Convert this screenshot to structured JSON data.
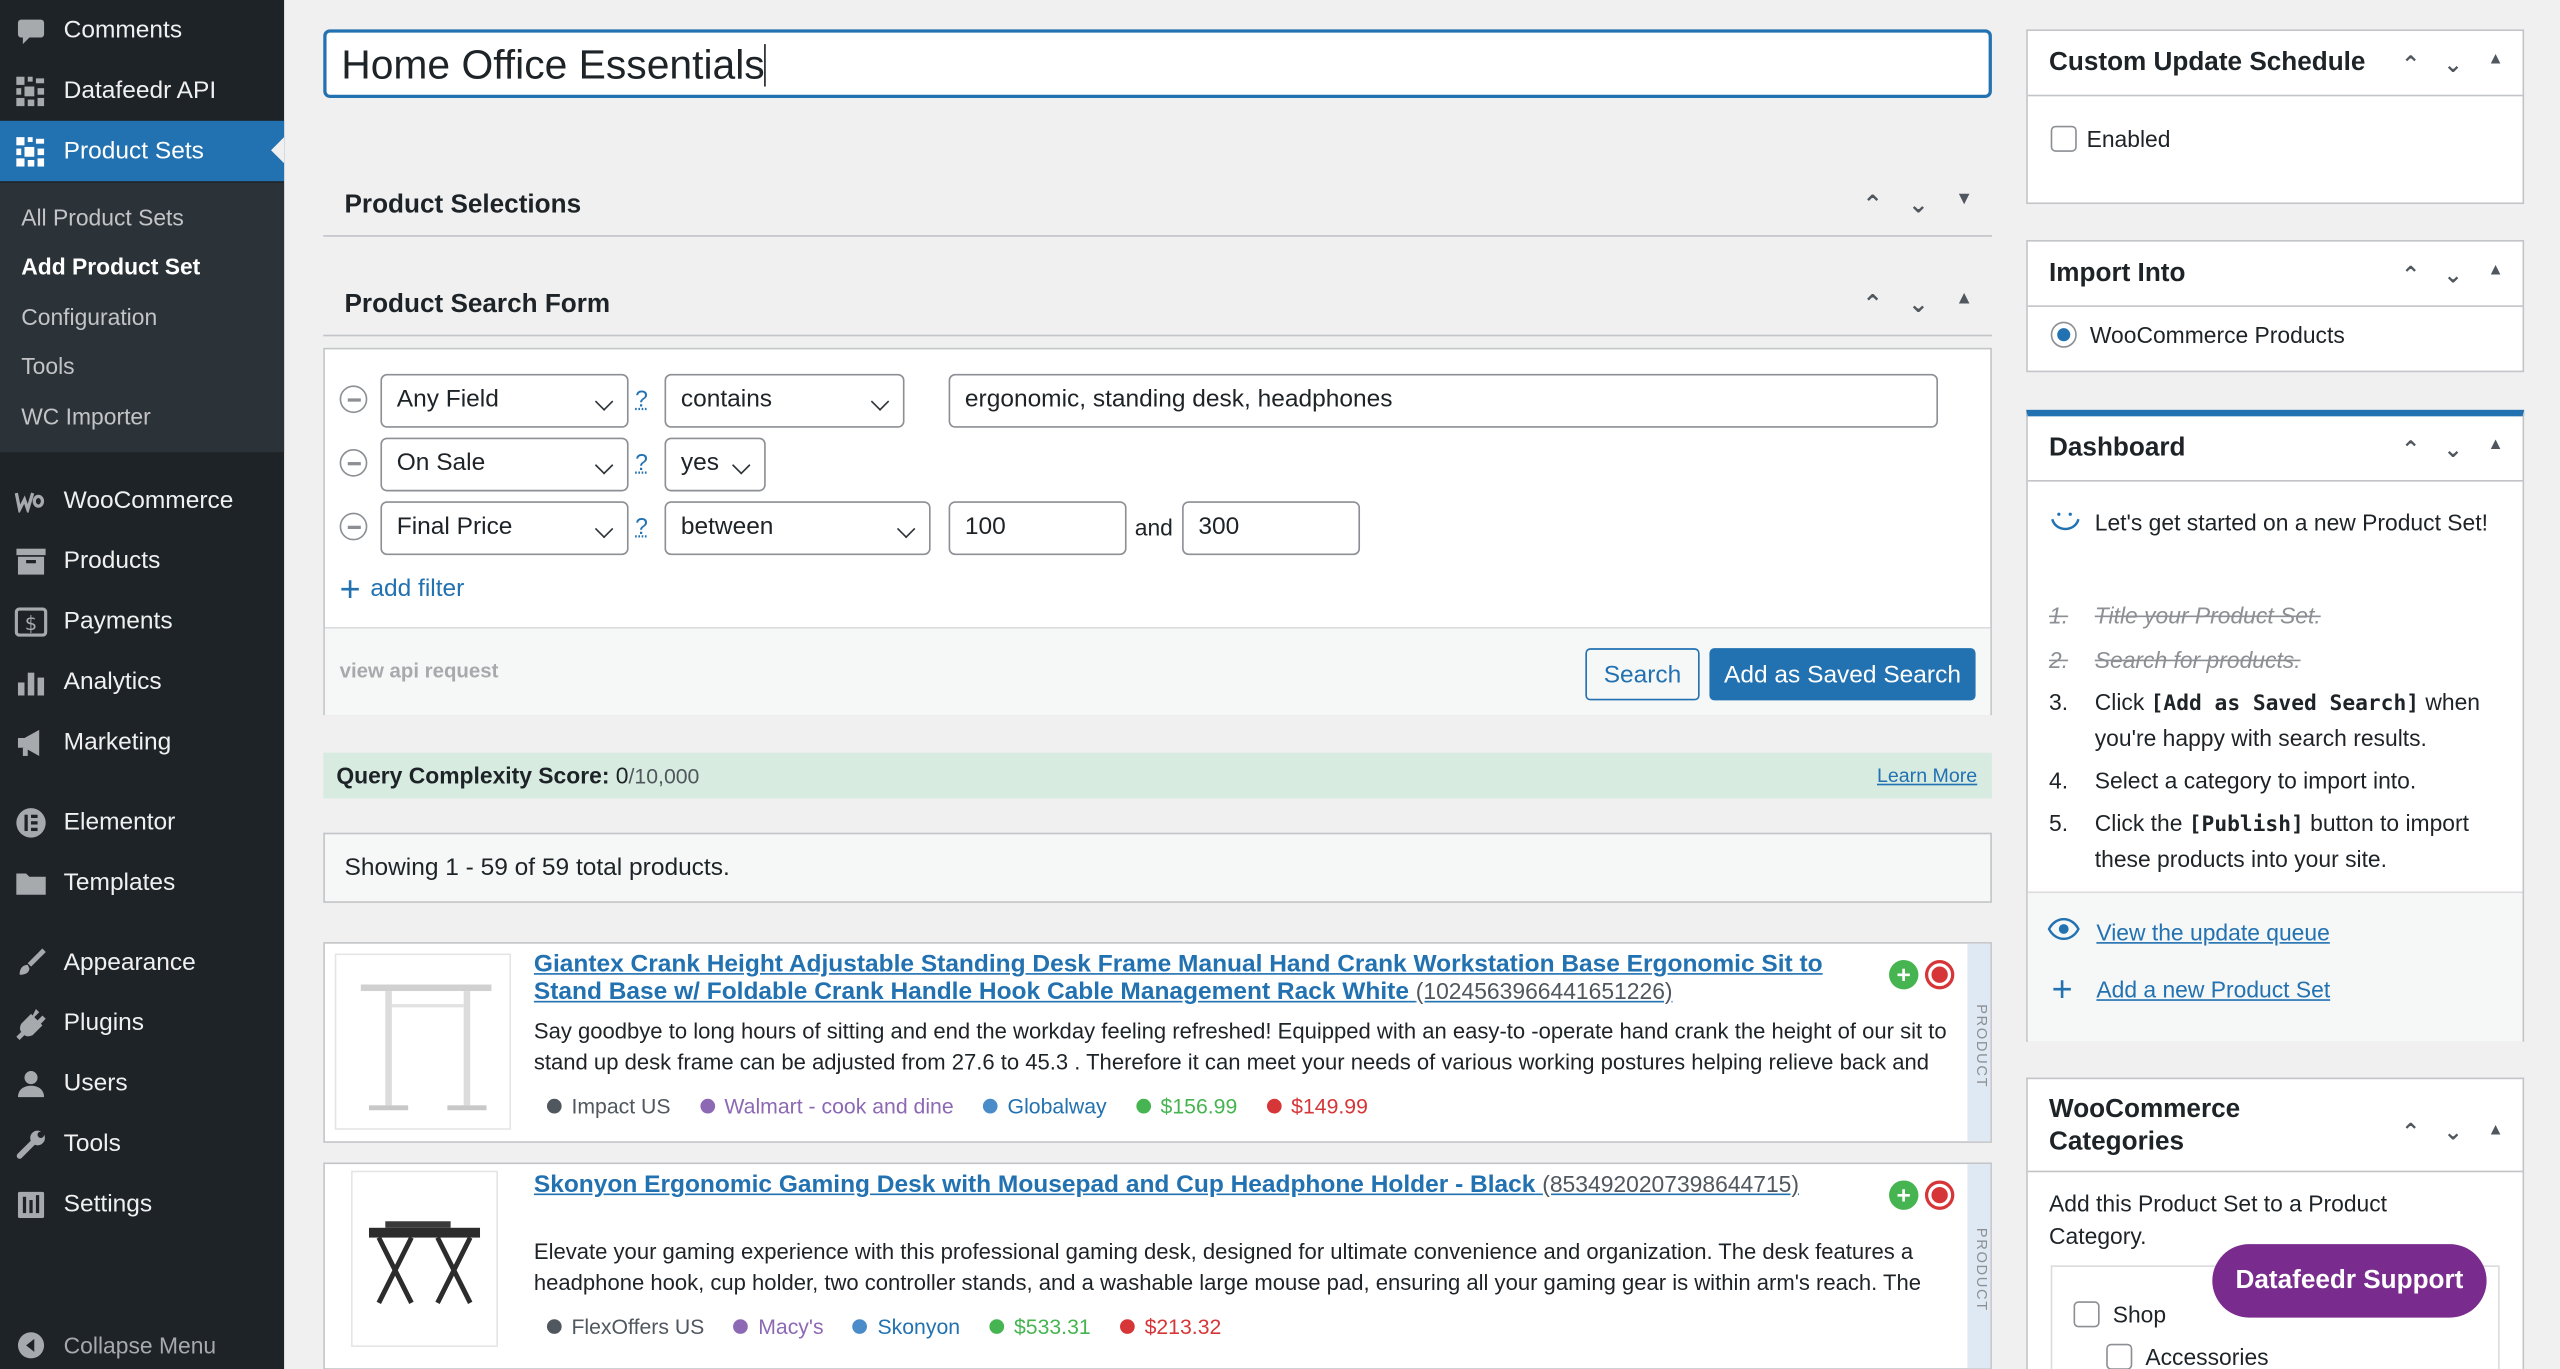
{
  "sidebar": {
    "top_items": [
      {
        "label": "Comments",
        "icon": "comment-icon"
      },
      {
        "label": "Datafeedr API",
        "icon": "grid-icon"
      },
      {
        "label": "Product Sets",
        "icon": "grid-icon"
      }
    ],
    "submenu": [
      "All Product Sets",
      "Add Product Set",
      "Configuration",
      "Tools",
      "WC Importer"
    ],
    "items": [
      {
        "label": "WooCommerce",
        "icon": "woo-icon"
      },
      {
        "label": "Products",
        "icon": "archive-icon"
      },
      {
        "label": "Payments",
        "icon": "dollar-icon"
      },
      {
        "label": "Analytics",
        "icon": "bar-chart-icon"
      },
      {
        "label": "Marketing",
        "icon": "megaphone-icon"
      },
      {
        "label": "Elementor",
        "icon": "elementor-icon"
      },
      {
        "label": "Templates",
        "icon": "folder-icon"
      },
      {
        "label": "Appearance",
        "icon": "brush-icon"
      },
      {
        "label": "Plugins",
        "icon": "plug-icon"
      },
      {
        "label": "Users",
        "icon": "user-icon"
      },
      {
        "label": "Tools",
        "icon": "wrench-icon"
      },
      {
        "label": "Settings",
        "icon": "settings-icon"
      }
    ],
    "collapse": "Collapse Menu"
  },
  "title_value": "Home Office Essentials",
  "boxes": {
    "selections": "Product Selections",
    "search_form": "Product Search Form"
  },
  "filters": [
    {
      "field": "Any Field",
      "op": "contains",
      "value": "ergonomic, standing desk, headphones"
    },
    {
      "field": "On Sale",
      "op": "yes"
    },
    {
      "field": "Final Price",
      "op": "between",
      "min": "100",
      "and": "and",
      "max": "300"
    }
  ],
  "help": "?",
  "add_filter": "add filter",
  "view_api": "view api request",
  "search_btn": "Search",
  "saved_btn": "Add as Saved Search",
  "complexity": {
    "label": "Query Complexity Score:",
    "score": "0",
    "max": "/10,000",
    "learn": "Learn More"
  },
  "showing": "Showing 1 - 59 of 59 total products.",
  "products": [
    {
      "title": "Giantex Crank Height Adjustable Standing Desk Frame Manual Hand Crank Workstation Base Ergonomic Sit to Stand Base w/ Foldable Crank Handle Hook Cable Management Rack White",
      "id": "(1024563966441651226)",
      "desc": "Say goodbye to long hours of sitting and end the workday feeling refreshed! Equipped with an easy-to -operate hand crank the height of our sit to stand up desk frame can be adjusted from 27.6 to 45.3 . Therefore it can meet your needs of various working postures helping relieve back and",
      "network": "Impact US",
      "merchant": "Walmart - cook and dine",
      "brand": "Globalway",
      "price": "$156.99",
      "sale": "$149.99"
    },
    {
      "title": "Skonyon Ergonomic Gaming Desk with Mousepad and Cup Headphone Holder - Black",
      "id": "(8534920207398644715)",
      "desc": "Elevate your gaming experience with this professional gaming desk, designed for ultimate convenience and organization. The desk features a headphone hook, cup holder, two controller stands, and a washable large mouse pad, ensuring all your gaming gear is within arm's reach. The",
      "network": "FlexOffers US",
      "merchant": "Macy's",
      "brand": "Skonyon",
      "price": "$533.31",
      "sale": "$213.32"
    }
  ],
  "product_strip": "PRODUCT",
  "right": {
    "schedule": {
      "title": "Custom Update Schedule",
      "enabled": "Enabled"
    },
    "import": {
      "title": "Import Into",
      "option": "WooCommerce Products"
    },
    "dashboard": {
      "title": "Dashboard",
      "intro": "Let's get started on a new Product Set!",
      "steps": [
        {
          "n": "1.",
          "text": "Title your Product Set."
        },
        {
          "n": "2.",
          "text": "Search for products."
        },
        {
          "n": "3.",
          "pre": "Click ",
          "bold": "[Add as Saved Search]",
          "post": " when you're happy with search results."
        },
        {
          "n": "4.",
          "text": "Select a category to import into."
        },
        {
          "n": "5.",
          "pre": "Click the ",
          "bold": "[Publish]",
          "post": " button to import these products into your site."
        }
      ],
      "view_queue": "View the update queue",
      "add_new": "Add a new Product Set"
    },
    "categories": {
      "title": "WooCommerce Categories",
      "desc": "Add this Product Set to a Product Category.",
      "items": [
        "Shop",
        "Accessories"
      ]
    }
  },
  "support": "Datafeedr Support",
  "colors": {
    "accent": "#2271b1",
    "sidebar": "#1d2327",
    "support": "#7a2c8e",
    "price": "#46b450",
    "sale": "#d63638"
  }
}
